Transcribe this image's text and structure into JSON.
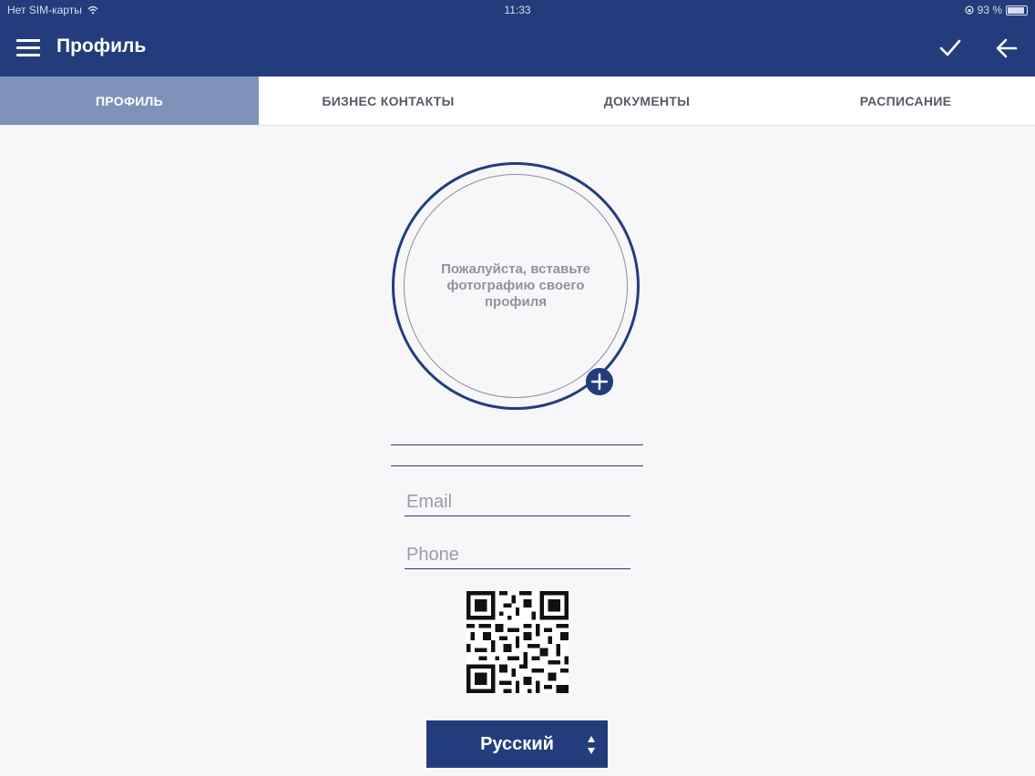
{
  "status_bar": {
    "carrier": "Нет SIM-карты",
    "time": "11:33",
    "battery": "93 %"
  },
  "header": {
    "title": "Профиль",
    "menu_icon": "hamburger-menu-icon",
    "confirm_icon": "checkmark-icon",
    "back_icon": "arrow-left-icon"
  },
  "tabs": [
    {
      "label": "ПРОФИЛЬ",
      "active": true
    },
    {
      "label": "БИЗНЕС КОНТАКТЫ",
      "active": false
    },
    {
      "label": "ДОКУМЕНТЫ",
      "active": false
    },
    {
      "label": "РАСПИСАНИЕ",
      "active": false
    }
  ],
  "profile": {
    "photo_hint": "Пожалуйста, вставьте фотографию своего профиля",
    "add_photo_icon": "plus-icon",
    "name_value": "",
    "surname_value": "",
    "email_placeholder": "Email",
    "email_value": "",
    "phone_placeholder": "Phone",
    "phone_value": "",
    "language": "Русский"
  },
  "colors": {
    "brand": "#233d7c",
    "active_tab": "#7d93ba",
    "background": "#f7f7f9"
  }
}
